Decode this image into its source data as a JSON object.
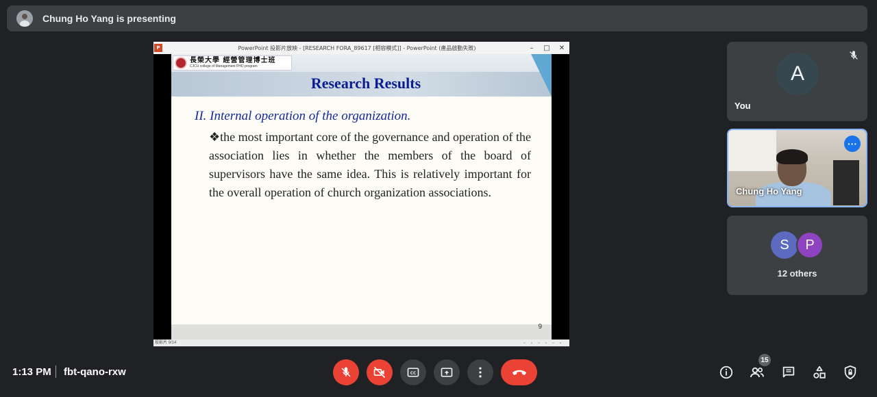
{
  "presenting_bar": {
    "text": "Chung Ho Yang is presenting",
    "avatar_icon": "person-photo-icon"
  },
  "shared_slide": {
    "window_title": "PowerPoint 投影片放映 - [RESEARCH FORA_89617 [相容模式]] - PowerPoint (產品啟動失敗)",
    "university_name_cn": "長榮大學 經營管理博士班",
    "university_name_en": "CJCU college of Management PHD program",
    "title": "Research Results",
    "heading": "II. Internal operation of the organization.",
    "body": "❖the most important core of the governance and operation of the association lies in whether the members of the board of supervisors have the same idea. This is relatively important for the overall operation of church organization associations.",
    "page_number": "9",
    "status_text": "投影片 9/14"
  },
  "participants": {
    "you": {
      "initial": "A",
      "name": "You",
      "muted": true
    },
    "presenter": {
      "name": "Chung Ho Yang",
      "more_icon": "more-options-icon"
    },
    "others": {
      "initials": [
        "S",
        "P"
      ],
      "label": "12 others"
    }
  },
  "meeting": {
    "time": "1:13 PM",
    "code": "fbt-qano-rxw",
    "participant_count": "15"
  },
  "colors": {
    "background": "#202124",
    "surface": "#3c4043",
    "danger": "#ea4335",
    "accent": "#8ab4f8",
    "slide_title": "#0b1e8f"
  }
}
